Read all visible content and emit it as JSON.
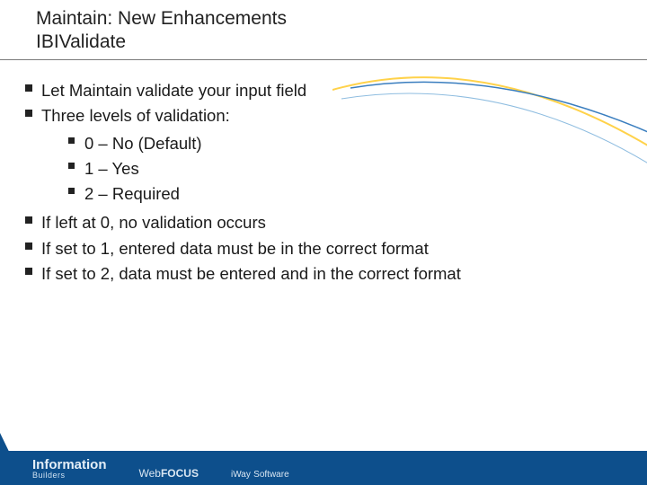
{
  "title": {
    "line1": "Maintain: New Enhancements",
    "line2": "IBIValidate"
  },
  "bullets": {
    "b1": "Let Maintain validate your input field",
    "b2": "Three levels of validation:",
    "sub": {
      "s1": "0 – No (Default)",
      "s2": "1 – Yes",
      "s3": "2 – Required"
    },
    "b3": "If left at 0, no validation occurs",
    "b4": "If set to 1, entered data must be in the correct format",
    "b5": "If set to 2, data must be entered and in the correct format"
  },
  "footer": {
    "brand_main": "Information",
    "brand_sub": "Builders",
    "wf_prefix": "Web",
    "wf_suffix": "FOCUS",
    "iway_main": "iWay",
    "iway_sub": "Software"
  }
}
